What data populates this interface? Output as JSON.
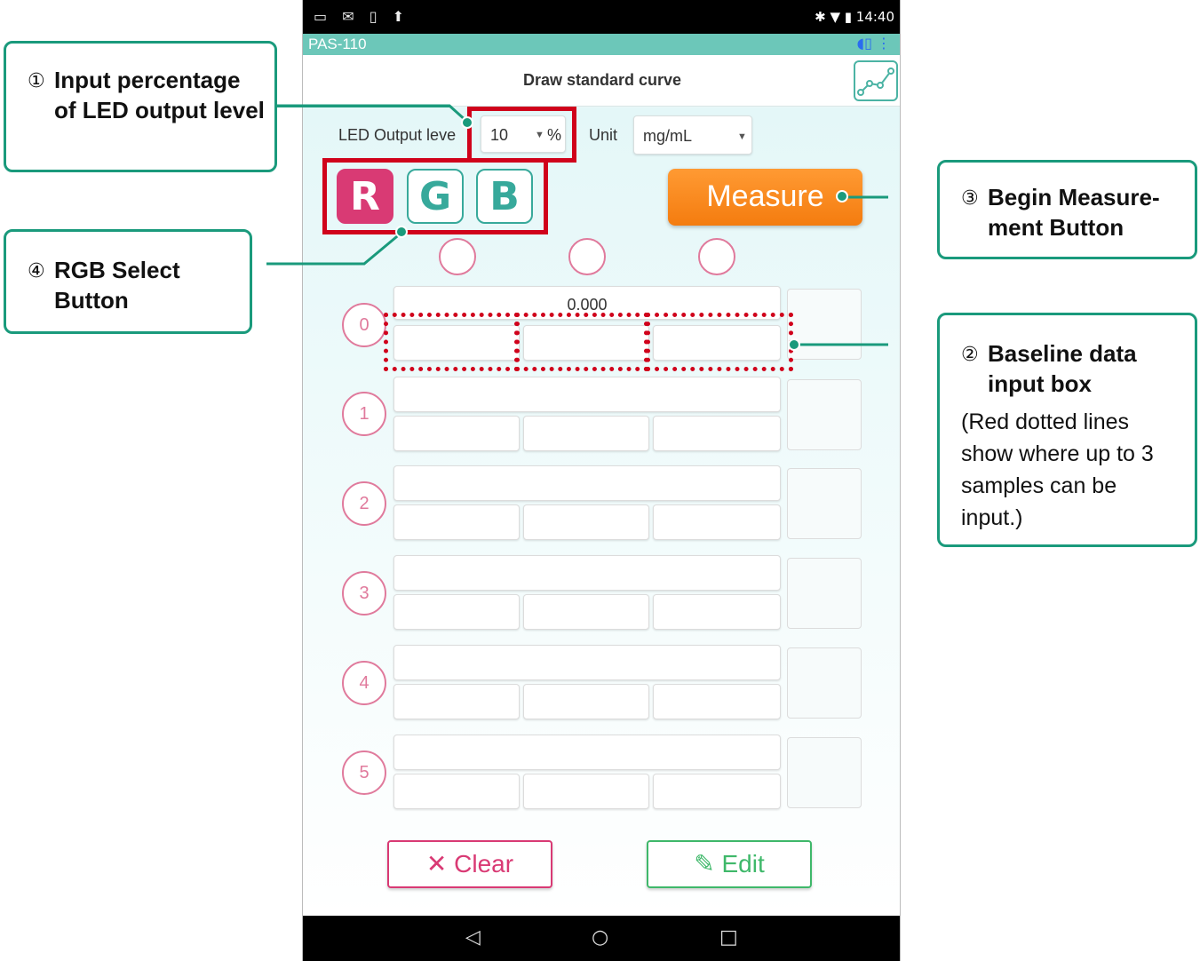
{
  "status_bar": {
    "left_icons": "▭ ✉ ▯ ⬆",
    "right": "✱ ▼ ▮ 14:40"
  },
  "app": {
    "title": "PAS-110",
    "header_icons": "◖▯ ⋮"
  },
  "screen": {
    "title": "Draw standard curve",
    "curve_icon": "chart-line-icon"
  },
  "led": {
    "label": "LED Output leve",
    "value": "10",
    "unit_suffix": "%"
  },
  "unit": {
    "label": "Unit",
    "value": "mg/mL"
  },
  "rgb": {
    "r": "R",
    "g": "G",
    "b": "B",
    "selected": "R"
  },
  "measure_label": "Measure",
  "rows": [
    {
      "num": "0",
      "top": "0.000"
    },
    {
      "num": "1",
      "top": ""
    },
    {
      "num": "2",
      "top": ""
    },
    {
      "num": "3",
      "top": ""
    },
    {
      "num": "4",
      "top": ""
    },
    {
      "num": "5",
      "top": ""
    }
  ],
  "buttons": {
    "clear": "Clear",
    "clear_icon": "✕",
    "edit": "Edit",
    "edit_icon": "✎"
  },
  "navbar": {
    "back": "◁",
    "home": "○",
    "recent": "□"
  },
  "callouts": {
    "c1": {
      "num": "①",
      "title": "Input percentage of LED output level"
    },
    "c2": {
      "num": "②",
      "title": "Baseline data input box",
      "body": "(Red dotted lines show where up to 3 samples can be input.)"
    },
    "c3": {
      "num": "③",
      "title": "Begin Measure-ment Button"
    },
    "c4": {
      "num": "④",
      "title": "RGB Select Button"
    }
  },
  "colors": {
    "accent": "#1a9a7c",
    "highlight": "#d0021b",
    "pink": "#d93a74",
    "orange": "#f47c0f",
    "green": "#3fb86a"
  }
}
